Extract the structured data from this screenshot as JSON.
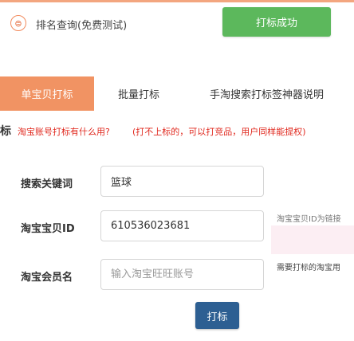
{
  "header": {
    "icon": "stamp-icon",
    "icon_glyph": "⊜",
    "title": "排名查询(免费测试)",
    "success_button": "打标成功"
  },
  "tabs": [
    {
      "label": "单宝贝打标",
      "active": true
    },
    {
      "label": "批量打标",
      "active": false
    },
    {
      "label": "手淘搜索打标签神器说明",
      "active": false
    }
  ],
  "tip": {
    "badge": "标",
    "question": "淘宝账号打标有什么用?",
    "answer": "(打不上标的，可以打竞品，用户同样能提权)"
  },
  "form": {
    "keyword": {
      "label": "搜索关键词",
      "value": "篮球"
    },
    "item_id": {
      "label": "淘宝宝贝ID",
      "value": "610536023681",
      "note": "淘宝宝贝ID为链接"
    },
    "member": {
      "label": "淘宝会员名",
      "placeholder": "输入淘宝旺旺账号",
      "note": "需要打标的淘宝用"
    }
  },
  "submit_button": "打标",
  "colors": {
    "accent_orange": "#f19363",
    "success_green": "#5cb85c",
    "submit_blue": "#2d5f92",
    "tip_red": "#e0281e"
  }
}
